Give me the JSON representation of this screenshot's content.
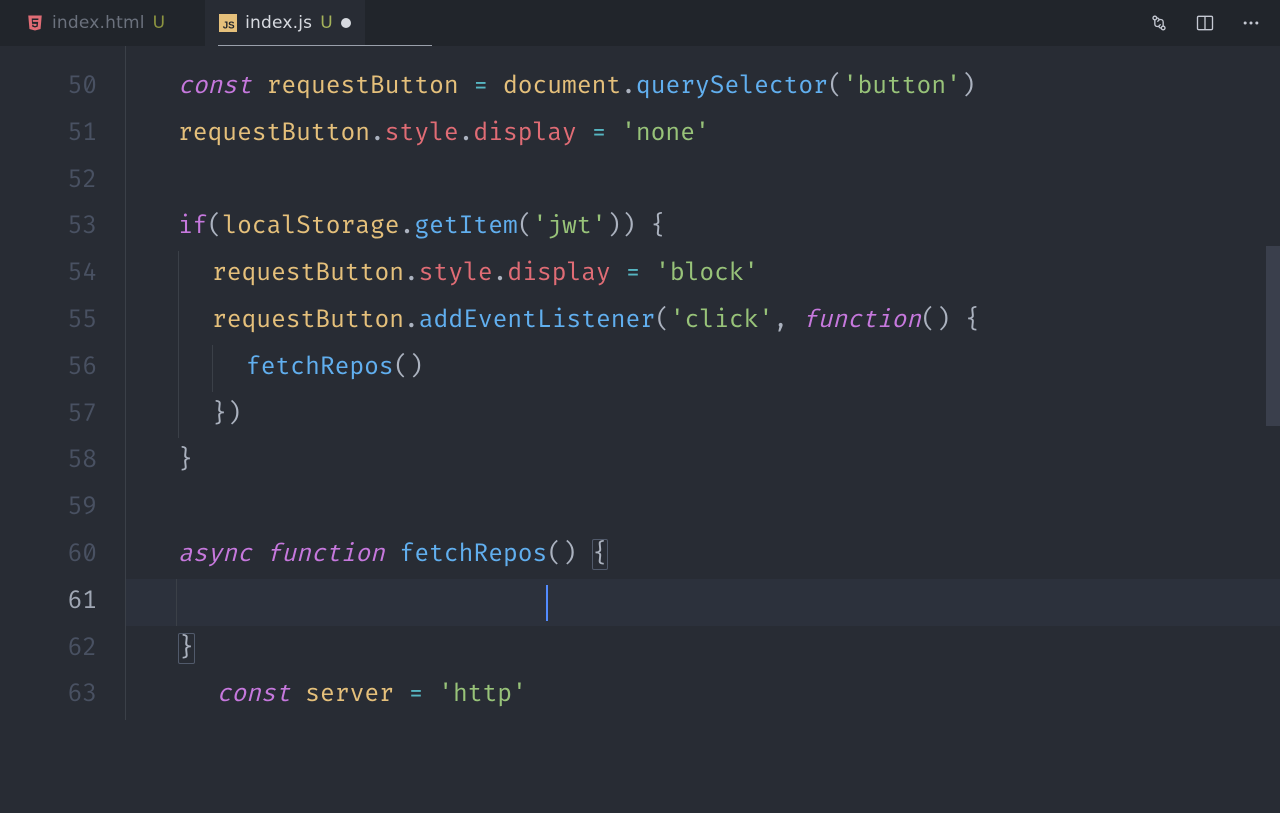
{
  "tabs": [
    {
      "icon": "html",
      "label": "index.html",
      "status": "U",
      "active": false
    },
    {
      "icon": "js",
      "label": "index.js",
      "status": "U",
      "active": true,
      "dirty": true
    }
  ],
  "gutter": {
    "start": 50,
    "end": 63,
    "current": 61
  },
  "code": {
    "l50": {
      "kw": "const",
      "name": "requestButton",
      "eq": "=",
      "doc": "document",
      "dot1": ".",
      "fn": "querySelector",
      "p": "(",
      "s": "'button'",
      "p2": ")"
    },
    "l51": {
      "obj": "requestButton",
      "d1": ".",
      "p1": "style",
      "d2": ".",
      "p2": "display",
      "eq": " = ",
      "s": "'none'"
    },
    "l53": {
      "kw": "if",
      "p": "(",
      "obj": "localStorage",
      "d": ".",
      "fn": "getItem",
      "p2": "(",
      "s": "'jwt'",
      "p3": ")",
      "p4": ")",
      "b": " {"
    },
    "l54": {
      "obj": "requestButton",
      "d1": ".",
      "p1": "style",
      "d2": ".",
      "p2": "display",
      "eq": " = ",
      "s": "'block'"
    },
    "l55": {
      "obj": "requestButton",
      "d": ".",
      "fn": "addEventListener",
      "p": "(",
      "s": "'click'",
      "c": ", ",
      "fnkw": "function",
      "p2": "()",
      "b": " {"
    },
    "l56": {
      "fn": "fetchRepos",
      "p": "()"
    },
    "l57": {
      "b": "})"
    },
    "l58": {
      "b": "}"
    },
    "l60": {
      "async": "async",
      "fnkw": "function",
      "name": "fetchRepos",
      "p": "()",
      "b": " {"
    },
    "l61": {
      "kw": "const",
      "name": "server",
      "eq": " = ",
      "s": "'http'"
    },
    "l62": {
      "b": "}"
    }
  },
  "icons": {
    "compare": "compare-icon",
    "split": "split-editor-icon",
    "more": "more-icon"
  }
}
